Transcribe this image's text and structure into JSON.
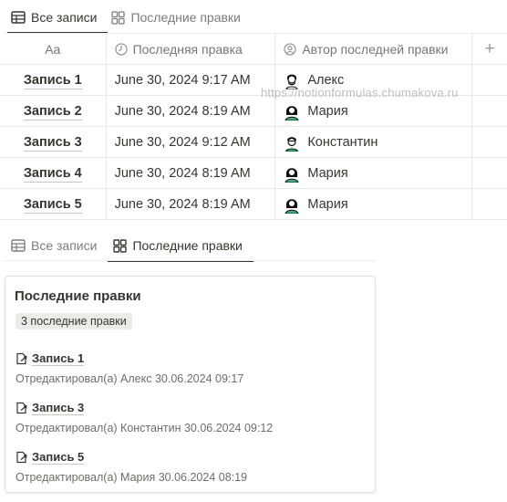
{
  "top_tabs": [
    {
      "label": "Все записи",
      "icon": "table-icon",
      "active": true
    },
    {
      "label": "Последние правки",
      "icon": "gallery-icon",
      "active": false
    }
  ],
  "table": {
    "columns": [
      {
        "label": "Aa",
        "icon": ""
      },
      {
        "label": "Последняя правка",
        "icon": "clock-icon"
      },
      {
        "label": "Автор последней правки",
        "icon": "person-icon"
      }
    ],
    "add_column_label": "+",
    "rows": [
      {
        "name": "Запись 1",
        "edited": "June 30, 2024 9:17 AM",
        "author": "Алекс"
      },
      {
        "name": "Запись 2",
        "edited": "June 30, 2024 8:19 AM",
        "author": "Мария"
      },
      {
        "name": "Запись 3",
        "edited": "June 30, 2024 9:12 AM",
        "author": "Константин"
      },
      {
        "name": "Запись 4",
        "edited": "June 30, 2024 8:19 AM",
        "author": "Мария"
      },
      {
        "name": "Запись 5",
        "edited": "June 30, 2024 8:19 AM",
        "author": "Мария"
      }
    ]
  },
  "watermark": "https://notionformulas.chumakova.ru",
  "bottom_tabs": [
    {
      "label": "Все записи",
      "icon": "table-icon",
      "active": false
    },
    {
      "label": "Последние правки",
      "icon": "gallery-icon",
      "active": true
    }
  ],
  "card": {
    "title": "Последние правки",
    "tag": "3 последние правки",
    "entries": [
      {
        "title": "Запись 1",
        "subtitle": "Отредактировал(а) Алекс 30.06.2024 09:17"
      },
      {
        "title": "Запись 3",
        "subtitle": "Отредактировал(а) Константин 30.06.2024 09:12"
      },
      {
        "title": "Запись 5",
        "subtitle": "Отредактировал(а) Мария 30.06.2024 08:19"
      }
    ]
  }
}
